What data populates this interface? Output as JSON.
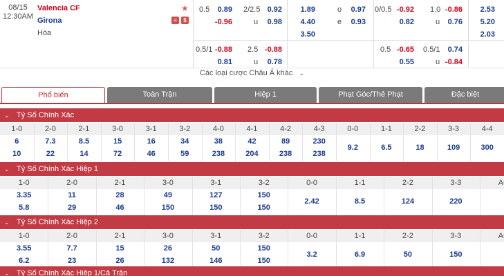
{
  "match": {
    "date": "08/15",
    "time": "12:30AM",
    "home": "Valencia CF",
    "away": "Girona",
    "draw": "Hòa",
    "more_label": "Các loại cược Châu Á khác"
  },
  "odds": {
    "ft_hdp_line1": "0.5",
    "ft_hdp_home1": "0.89",
    "ft_hdp_away1": "-0.96",
    "ft_ou_line1": "2/2.5",
    "ft_ou_over1": "0.92",
    "ft_ou_under1": "0.98",
    "ft_ou_u_label": "u",
    "ft_1x2_home": "1.89",
    "ft_1x2_away": "4.40",
    "ft_1x2_draw": "3.50",
    "oe_o_label": "o",
    "oe_e_label": "e",
    "oe_o": "0.97",
    "oe_e": "0.93",
    "ft_hdp_line2": "0.5/1",
    "ft_hdp_home2": "-0.88",
    "ft_hdp_away2": "0.81",
    "ft_ou_line2": "2.5",
    "ft_ou_over2": "-0.88",
    "ft_ou_under2": "0.78",
    "h1_hdp_line1": "0/0.5",
    "h1_hdp_home1": "-0.92",
    "h1_hdp_away1": "0.82",
    "h1_ou_line1": "1.0",
    "h1_ou_over1": "-0.86",
    "h1_ou_under1": "0.76",
    "h1_1x2_home": "2.53",
    "h1_1x2_away": "5.20",
    "h1_1x2_draw": "2.03",
    "h1_hdp_line2": "0.5",
    "h1_hdp_home2": "-0.65",
    "h1_hdp_away2": "0.55",
    "h1_ou_line2": "0.5/1",
    "h1_ou_over2": "0.74",
    "h1_ou_under2": "-0.84"
  },
  "tabs": [
    "Phổ biến",
    "Toàn Trận",
    "Hiệp 1",
    "Phạt Góc/Thẻ Phạt",
    "Đặc biệt"
  ],
  "sections": [
    {
      "title": "Tỷ Số Chính Xác",
      "home_scores": [
        "1-0",
        "2-0",
        "2-1",
        "3-0",
        "3-1",
        "3-2",
        "4-0",
        "4-1",
        "4-2",
        "4-3"
      ],
      "home_odds": [
        "6",
        "7.3",
        "8.5",
        "15",
        "16",
        "34",
        "38",
        "42",
        "89",
        "230"
      ],
      "away_odds": [
        "10",
        "22",
        "14",
        "72",
        "46",
        "59",
        "238",
        "204",
        "238",
        "238"
      ],
      "draw_scores": [
        "0-0",
        "1-1",
        "2-2",
        "3-3",
        "4-4"
      ],
      "draw_odds": [
        "9.2",
        "6.5",
        "18",
        "109",
        "300"
      ]
    },
    {
      "title": "Tỷ Số Chính Xác Hiệp 1",
      "home_scores": [
        "1-0",
        "2-0",
        "2-1",
        "3-0",
        "3-1",
        "3-2"
      ],
      "home_odds": [
        "3.35",
        "11",
        "28",
        "49",
        "127",
        "150"
      ],
      "away_odds": [
        "5.8",
        "29",
        "46",
        "150",
        "150",
        "150"
      ],
      "draw_scores": [
        "0-0",
        "1-1",
        "2-2",
        "3-3",
        "AO"
      ],
      "draw_odds": [
        "2.42",
        "8.5",
        "124",
        "220",
        "—"
      ]
    },
    {
      "title": "Tỷ Số Chính Xác Hiệp 2",
      "home_scores": [
        "1-0",
        "2-0",
        "2-1",
        "3-0",
        "3-1",
        "3-2"
      ],
      "home_odds": [
        "3.55",
        "7.7",
        "15",
        "26",
        "50",
        "150"
      ],
      "away_odds": [
        "6.2",
        "23",
        "26",
        "132",
        "146",
        "150"
      ],
      "draw_scores": [
        "0-0",
        "1-1",
        "2-2",
        "3-3",
        "AO"
      ],
      "draw_odds": [
        "3.2",
        "6.9",
        "50",
        "150",
        "—"
      ]
    },
    {
      "title": "Tỷ Số Chính Xác Hiệp 1/Cả Trận"
    }
  ]
}
